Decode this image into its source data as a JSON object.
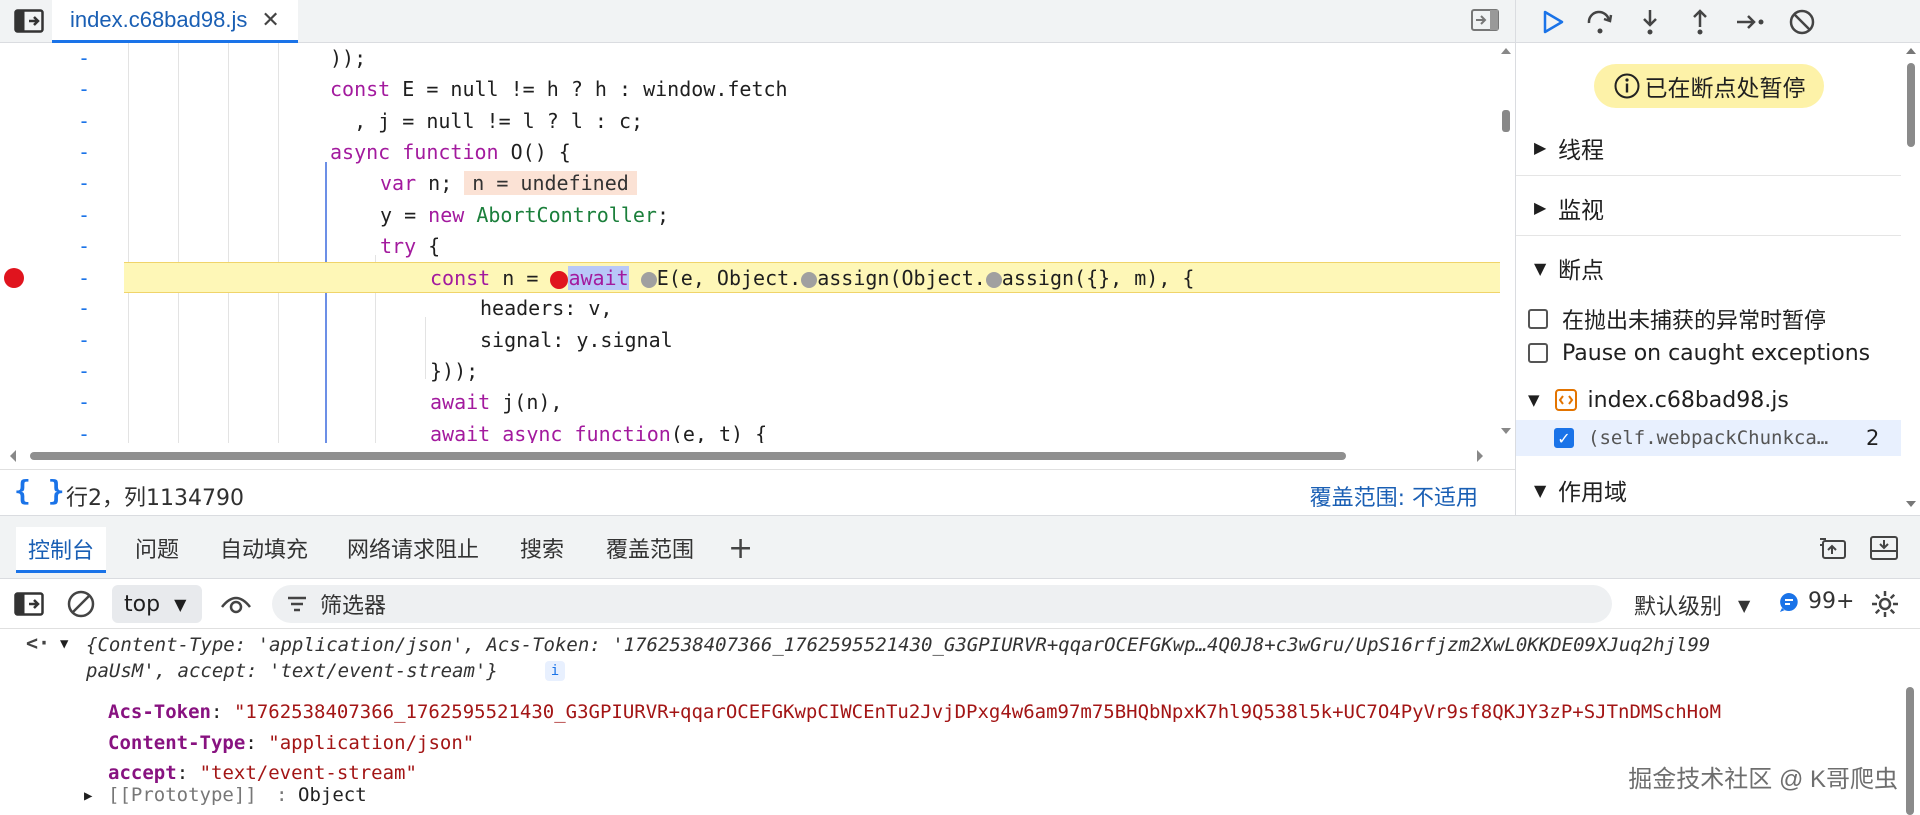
{
  "editor": {
    "tab_name": "index.c68bad98.js",
    "close_glyph": "✕",
    "gutter_marker": "-",
    "lines": [
      {
        "text": "));"
      },
      {
        "kw": "const",
        "text": " E = null != h ? h : window.fetch"
      },
      {
        "text": "  , j = null != l ? l : c;"
      },
      {
        "kw": "async function",
        "text": " O() {"
      },
      {
        "kw": "var",
        "text": " n;",
        "inline": "n = undefined"
      },
      {
        "text": "y = ",
        "kw": "new",
        "cls": "AbortController",
        "tail": ";"
      },
      {
        "kw": "try",
        "text": " {"
      },
      {
        "paused": true,
        "pre_kw": "const",
        "pre": " n = ",
        "await": "await",
        "rest1": "E(e, Object.",
        "rest2": "assign(Object.",
        "rest3": "assign({}, m), {"
      },
      {
        "text": "headers: v,"
      },
      {
        "text": "signal: y.signal"
      },
      {
        "text": "}));"
      },
      {
        "kw": "await",
        "text": " j(n),"
      },
      {
        "kw": "await async function",
        "text": "(e, t) {"
      }
    ]
  },
  "status": {
    "pretty_print": "{ }",
    "cursor_position": "行2，列1134790",
    "coverage": "覆盖范围: 不适用"
  },
  "sidebar": {
    "paused_banner": "已在断点处暂停",
    "sections": {
      "threads": "线程",
      "watch": "监视",
      "breakpoints": "断点",
      "scope": "作用域"
    },
    "pause_uncaught": "在抛出未捕获的异常时暂停",
    "pause_caught": "Pause on caught exceptions",
    "bp_file": "index.c68bad98.js",
    "bp_entry_text": "(self.webpackChunkca…",
    "bp_entry_line": "2"
  },
  "drawer": {
    "tabs": [
      "控制台",
      "问题",
      "自动填充",
      "网络请求阻止",
      "搜索",
      "覆盖范围"
    ],
    "add_tab": "+",
    "context": "top",
    "filter_placeholder": "筛选器",
    "levels": "默认级别",
    "message_count": "99+"
  },
  "console": {
    "summary_1": "{Content-Type: 'application/json', Acs-Token: '1762538407366_1762595521430_G3GPIURVR+qqarOCEFGKwp…4Q0J8+c3wGru/UpS16rfjzm2XwL0KKDE09XJuq2hjl99",
    "summary_2": "paUsM', accept: 'text/event-stream'}",
    "info_badge": "i",
    "props": [
      {
        "key": "Acs-Token",
        "value": "\"1762538407366_1762595521430_G3GPIURVR+qqarOCEFGKwpCIWCEnTu2JvjDPxg4w6am97m75BHQbNpxK7hl9Q538l5k+UC7O4PyVr9sf8QKJY3zP+SJTnDMSchHoM"
      },
      {
        "key": "Content-Type",
        "value": "\"application/json\""
      },
      {
        "key": "accept",
        "value": "\"text/event-stream\""
      }
    ],
    "prototype_key": "[[Prototype]]",
    "prototype_value": "Object",
    "watermark": "掘金技术社区 @ K哥爬虫"
  }
}
